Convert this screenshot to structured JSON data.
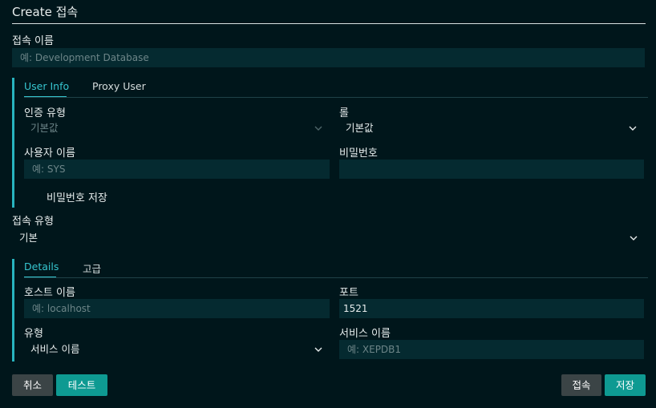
{
  "dialog": {
    "title": "Create 접속"
  },
  "connection_name": {
    "label": "접속 이름",
    "placeholder": "예: Development Database"
  },
  "auth_tabs": {
    "tabs": [
      "User Info",
      "Proxy User"
    ],
    "active": "User Info"
  },
  "user_info": {
    "auth_type_label": "인증 유형",
    "auth_type_value": "기본값",
    "role_label": "롤",
    "role_value": "기본값",
    "username_label": "사용자 이름",
    "username_placeholder": "예: SYS",
    "password_label": "비밀번호",
    "password_value": "",
    "save_password_label": "비밀번호 저장"
  },
  "connection_type": {
    "label": "접속 유형",
    "value": "기본"
  },
  "detail_tabs": {
    "tabs": [
      "Details",
      "고급"
    ],
    "active": "Details"
  },
  "details": {
    "host_label": "호스트 이름",
    "host_placeholder": "예: localhost",
    "port_label": "포트",
    "port_value": "1521",
    "type_label": "유형",
    "type_value": "서비스 이름",
    "service_label": "서비스 이름",
    "service_placeholder": "예: XEPDB1"
  },
  "buttons": {
    "cancel": "취소",
    "test": "테스트",
    "connect": "접속",
    "save": "저장"
  },
  "colors": {
    "background": "#00161b",
    "input": "#052a30",
    "accent": "#28b4bf",
    "button_primary": "#0e9a92",
    "button_secondary": "#3b4446"
  },
  "icons": {
    "dropdown": "chevron-down-icon"
  }
}
